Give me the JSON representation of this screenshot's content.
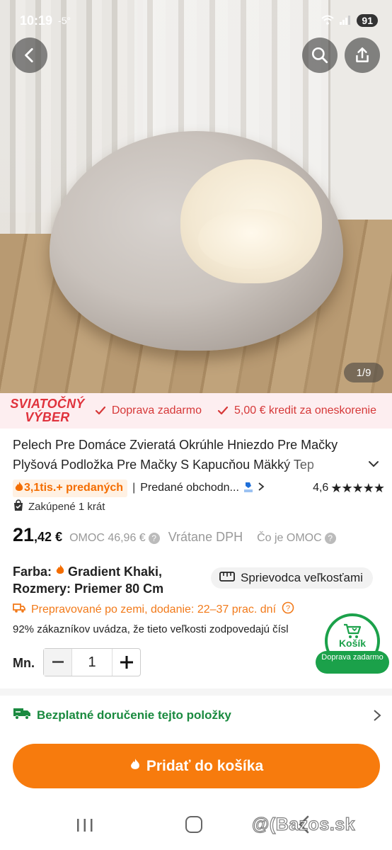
{
  "status_bar": {
    "time": "10:19",
    "temperature": "-5°",
    "battery": "91"
  },
  "gallery": {
    "counter": "1/9"
  },
  "promo": {
    "badge_line1": "SVIATOČNÝ",
    "badge_line2": "VÝBER",
    "items": [
      "Doprava zadarmo",
      "5,00 € kredit za oneskorenie"
    ]
  },
  "product": {
    "title_line1": "Pelech Pre Domáce Zvieratá Okrúhle Hniezdo Pre Mačky",
    "title_line2": "Plyšová Podložka Pre Mačky S Kapucňou Mäkký Tep",
    "sold": "3,1tis.+ predaných",
    "sold_by": "Predané obchodn...",
    "rating": "4,6",
    "stars": "★★★★★",
    "bought": "Zakúpené 1 krát"
  },
  "price": {
    "integer": "21",
    "decimal": ",42 €",
    "omoc": "OMOC 46,96 €",
    "vat": "Vrátane DPH",
    "what_is": "Čo je OMOC"
  },
  "variant": {
    "color_label": "Farba:",
    "color_value": "Gradient Khaki,",
    "size_label": "Rozmery:",
    "size_value": "Priemer 80 Cm",
    "size_guide": "Sprievodca veľkosťami"
  },
  "shipping": {
    "text": "Prepravované po zemi, dodanie: 22–37 prac. dní",
    "fit_note": "92% zákazníkov uvádza, že tieto veľkosti zodpovedajú čísl"
  },
  "quantity": {
    "label": "Mn.",
    "value": "1"
  },
  "cart_float": {
    "label": "Košík",
    "tag": "Doprava zadarmo"
  },
  "free_delivery": "Bezplatné doručenie tejto položky",
  "add_to_cart": "Pridať do košíka",
  "watermark": "@(Bazos.sk",
  "colors": {
    "accent": "#f77b0d",
    "promo_red": "#e0323c",
    "green": "#1ba14a"
  }
}
